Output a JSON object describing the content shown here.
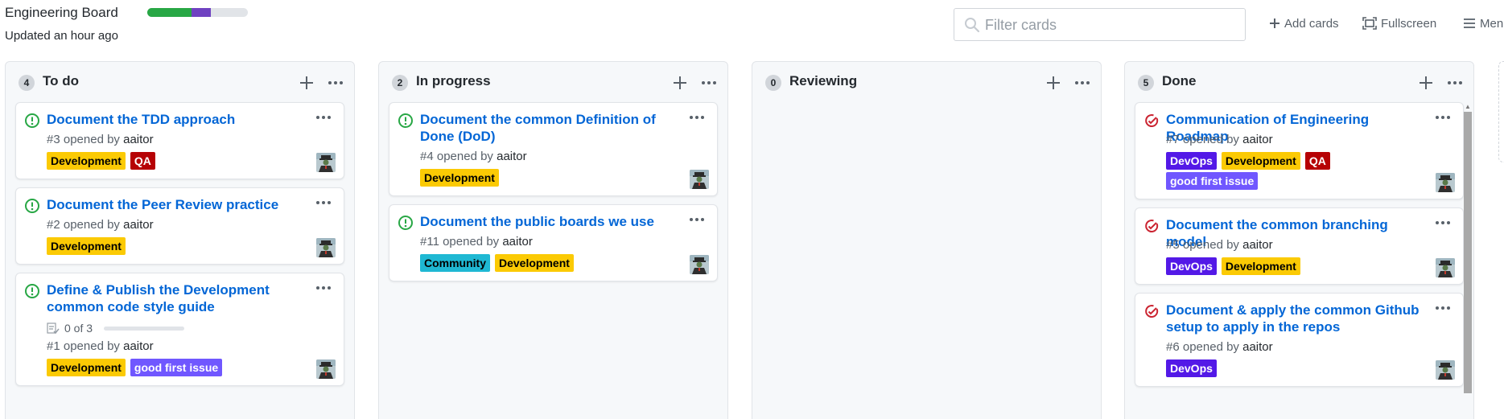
{
  "header": {
    "title": "Engineering Board",
    "updated": "Updated an hour ago",
    "progress": {
      "done_fraction": 0.44,
      "in_progress_fraction": 0.19,
      "colors": {
        "done": "#28a745",
        "in_progress": "#6f42c1",
        "rest": "#e1e4e8"
      }
    },
    "filter_placeholder": "Filter cards",
    "add_cards_label": "Add cards",
    "fullscreen_label": "Fullscreen",
    "menu_label": "Menu"
  },
  "colors": {
    "link": "#0366d6",
    "open_icon": "#28a745",
    "closed_icon": "#cb2431",
    "labels": {
      "Development": {
        "bg": "#fbca04",
        "fg": "#000000"
      },
      "QA": {
        "bg": "#b60205",
        "fg": "#ffffff"
      },
      "good first issue": {
        "bg": "#7057ff",
        "fg": "#ffffff"
      },
      "Community": {
        "bg": "#1fb8d3",
        "fg": "#000000"
      },
      "DevOps": {
        "bg": "#5319e7",
        "fg": "#ffffff"
      }
    }
  },
  "columns": [
    {
      "name": "To do",
      "count": "4",
      "cards": [
        {
          "state": "open",
          "title": "Document the TDD approach",
          "number": "#3",
          "opened_by": "opened by",
          "author": "aaitor",
          "labels": [
            "Development",
            "QA"
          ]
        },
        {
          "state": "open",
          "title": "Document the Peer Review practice",
          "number": "#2",
          "opened_by": "opened by",
          "author": "aaitor",
          "labels": [
            "Development"
          ]
        },
        {
          "state": "open",
          "title": "Define & Publish the Development common code style guide",
          "checklist": "0 of 3",
          "number": "#1",
          "opened_by": "opened by",
          "author": "aaitor",
          "labels": [
            "Development",
            "good first issue"
          ]
        }
      ]
    },
    {
      "name": "In progress",
      "count": "2",
      "cards": [
        {
          "state": "open",
          "title": "Document the common Definition of Done (DoD)",
          "number": "#4",
          "opened_by": "opened by",
          "author": "aaitor",
          "labels": [
            "Development"
          ]
        },
        {
          "state": "open",
          "title": "Document the public boards we use",
          "number": "#11",
          "opened_by": "opened by",
          "author": "aaitor",
          "labels": [
            "Community",
            "Development"
          ]
        }
      ]
    },
    {
      "name": "Reviewing",
      "count": "0",
      "cards": []
    },
    {
      "name": "Done",
      "count": "5",
      "cards": [
        {
          "state": "closed",
          "title": "Communication of Engineering Roadmap",
          "number": "#7",
          "opened_by": "opened by",
          "author": "aaitor",
          "labels": [
            "DevOps",
            "Development",
            "QA",
            "good first issue"
          ]
        },
        {
          "state": "closed",
          "title": "Document the common branching model",
          "number": "#5",
          "opened_by": "opened by",
          "author": "aaitor",
          "labels": [
            "DevOps",
            "Development"
          ]
        },
        {
          "state": "closed",
          "title": "Document & apply the common Github setup to apply in the repos",
          "number": "#6",
          "opened_by": "opened by",
          "author": "aaitor",
          "labels": [
            "DevOps"
          ]
        }
      ]
    }
  ]
}
